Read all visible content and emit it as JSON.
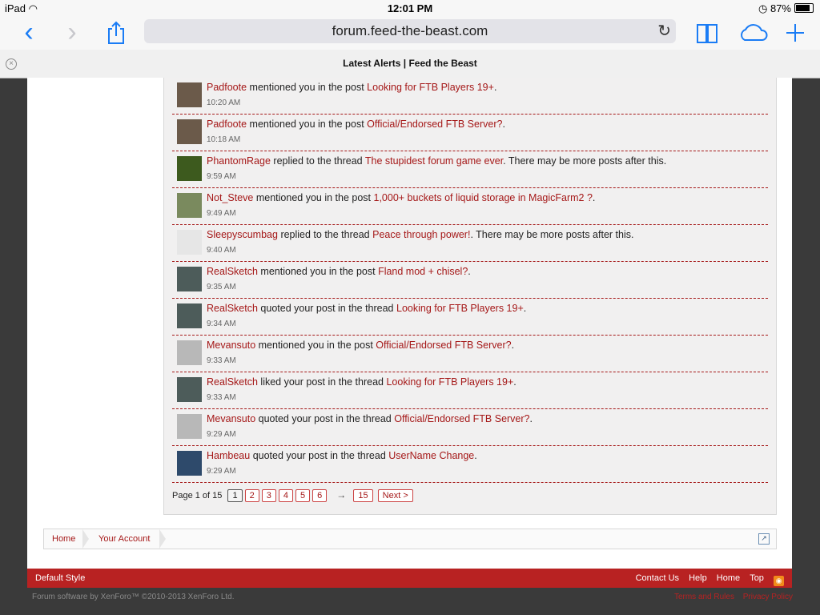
{
  "status": {
    "device": "iPad",
    "time": "12:01 PM",
    "battery": "87%"
  },
  "browser": {
    "url": "forum.feed-the-beast.com",
    "tab_title": "Latest Alerts | Feed the Beast"
  },
  "alerts": [
    {
      "user": "Padfoote",
      "action": "mentioned you in the post",
      "link": "Looking for FTB Players 19+",
      "suffix": ".",
      "time": "10:20 AM",
      "avatar_color": "#6b5a4a"
    },
    {
      "user": "Padfoote",
      "action": "mentioned you in the post",
      "link": "Official/Endorsed FTB Server?",
      "suffix": ".",
      "time": "10:18 AM",
      "avatar_color": "#6b5a4a"
    },
    {
      "user": "PhantomRage",
      "action": "replied to the thread",
      "link": "The stupidest forum game ever",
      "suffix": ". There may be more posts after this.",
      "time": "9:59 AM",
      "avatar_color": "#3d5a1e"
    },
    {
      "user": "Not_Steve",
      "action": "mentioned you in the post",
      "link": "1,000+ buckets of liquid storage in MagicFarm2 ?",
      "suffix": ".",
      "time": "9:49 AM",
      "avatar_color": "#7a8a5e"
    },
    {
      "user": "Sleepyscumbag",
      "action": "replied to the thread",
      "link": "Peace through power!",
      "suffix": ". There may be more posts after this.",
      "time": "9:40 AM",
      "avatar_color": "#e6e6e6"
    },
    {
      "user": "RealSketch",
      "action": "mentioned you in the post",
      "link": "Fland mod + chisel?",
      "suffix": ".",
      "time": "9:35 AM",
      "avatar_color": "#4d5c5a"
    },
    {
      "user": "RealSketch",
      "action": "quoted your post in the thread",
      "link": "Looking for FTB Players 19+",
      "suffix": ".",
      "time": "9:34 AM",
      "avatar_color": "#4d5c5a"
    },
    {
      "user": "Mevansuto",
      "action": "mentioned you in the post",
      "link": "Official/Endorsed FTB Server?",
      "suffix": ".",
      "time": "9:33 AM",
      "avatar_color": "#b8b8b8"
    },
    {
      "user": "RealSketch",
      "action": "liked your post in the thread",
      "link": "Looking for FTB Players 19+",
      "suffix": ".",
      "time": "9:33 AM",
      "avatar_color": "#4d5c5a"
    },
    {
      "user": "Mevansuto",
      "action": "quoted your post in the thread",
      "link": "Official/Endorsed FTB Server?",
      "suffix": ".",
      "time": "9:29 AM",
      "avatar_color": "#b8b8b8"
    },
    {
      "user": "Hambeau",
      "action": "quoted your post in the thread",
      "link": "UserName Change",
      "suffix": ".",
      "time": "9:29 AM",
      "avatar_color": "#2e4a6b"
    }
  ],
  "pager": {
    "label": "Page 1 of 15",
    "pages": [
      "1",
      "2",
      "3",
      "4",
      "5",
      "6"
    ],
    "arrow": "→",
    "last": "15",
    "next": "Next >"
  },
  "breadcrumb": {
    "home": "Home",
    "account": "Your Account"
  },
  "footer": {
    "style": "Default Style",
    "contact": "Contact Us",
    "help": "Help",
    "home": "Home",
    "top": "Top",
    "copyright": "Forum software by XenForo™ ©2010-2013 XenForo Ltd.",
    "terms": "Terms and Rules",
    "privacy": "Privacy Policy"
  }
}
